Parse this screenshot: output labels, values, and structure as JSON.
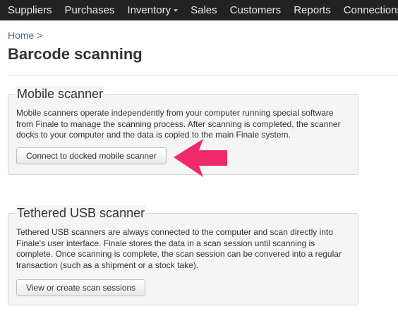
{
  "navbar": {
    "items": [
      {
        "label": "Suppliers"
      },
      {
        "label": "Purchases"
      },
      {
        "label": "Inventory",
        "has_dropdown": true
      },
      {
        "label": "Sales"
      },
      {
        "label": "Customers"
      },
      {
        "label": "Reports"
      },
      {
        "label": "Connections"
      }
    ]
  },
  "breadcrumb": {
    "home": "Home",
    "separator": ">"
  },
  "page": {
    "title": "Barcode scanning"
  },
  "mobile_scanner": {
    "title": "Mobile scanner",
    "description": "Mobile scanners operate independently from your computer running special software from Finale to manage the scanning process. After scanning is completed, the scanner docks to your computer and the data is copied to the main Finale system.",
    "button_label": "Connect to docked mobile scanner"
  },
  "usb_scanner": {
    "title": "Tethered USB scanner",
    "description": "Tethered USB scanners are always connected to the computer and scan directly into Finale's user interface. Finale stores the data in a scan session until scanning is complete. Once scanning is complete, the scan session can be convered into a regular transaction (such as a shipment or a stock take).",
    "button_label": "View or create scan sessions"
  },
  "colors": {
    "navbar_bg": "#222222",
    "link": "#4d6a88",
    "annotation_arrow": "#f0296b"
  }
}
